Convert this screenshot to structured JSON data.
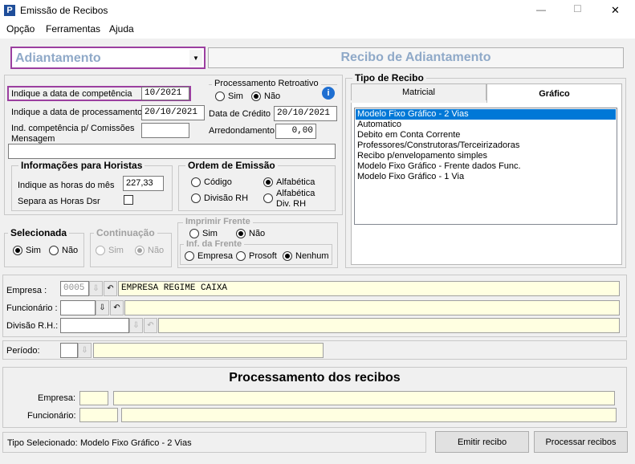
{
  "window": {
    "title": "Emissão de Recibos",
    "minimize": "—",
    "maximize": "☐",
    "close": "✕"
  },
  "menu": {
    "items": [
      "Opção",
      "Ferramentas",
      "Ajuda"
    ]
  },
  "top": {
    "type_value": "Adiantamento",
    "banner": "Recibo de Adiantamento"
  },
  "dates": {
    "competencia_label": "Indique a data de competência",
    "competencia_value": "10/2021",
    "processamento_label": "Indique a data de processamento",
    "processamento_value": "20/10/2021",
    "comissoes_label": "Ind. competência p/ Comissões",
    "mensagem_label": "Mensagem",
    "mensagem_value": "",
    "comissoes_value": ""
  },
  "retro": {
    "title": "Processamento Retroativo",
    "sim": "Sim",
    "nao": "Não",
    "selected": "nao"
  },
  "credito": {
    "label": "Data de Crédito",
    "value": "20/10/2021"
  },
  "arred": {
    "label": "Arredondamento",
    "value": "0,00"
  },
  "horistas": {
    "title": "Informações para Horistas",
    "horas_label": "Indique as horas do mês",
    "horas_value": "227,33",
    "dsr_label": "Separa as Horas Dsr"
  },
  "ordem": {
    "title": "Ordem de Emissão",
    "codigo": "Código",
    "alfabetica": "Alfabética",
    "divisao": "Divisão RH",
    "alfa_div": "Alfabética Div. RH",
    "selected": "alfabetica"
  },
  "tipo": {
    "title": "Tipo de Recibo",
    "tabs": [
      "Matricial",
      "Gráfico"
    ],
    "active_tab": 1,
    "items": [
      "Modelo Fixo Gráfico - 2 Vias",
      "Automatico",
      "Debito em Conta Corrente",
      "Professores/Construtoras/Terceirizadoras",
      "Recibo p/envelopamento simples",
      "Modelo Fixo Gráfico - Frente dados Func.",
      "Modelo Fixo Gráfico - 1 Via"
    ],
    "selected": 0
  },
  "selecionada": {
    "title": "Selecionada",
    "sim": "Sim",
    "nao": "Não"
  },
  "continuacao": {
    "title": "Continuação",
    "sim": "Sim",
    "nao": "Não"
  },
  "frente": {
    "title": "Imprimir Frente",
    "sim": "Sim",
    "nao": "Não",
    "inf_title": "Inf. da Frente",
    "empresa": "Empresa",
    "prosoft": "Prosoft",
    "nenhum": "Nenhum"
  },
  "filters": {
    "empresa_label": "Empresa :",
    "empresa_code": "0005",
    "empresa_name": "EMPRESA REGIME CAIXA",
    "funcionario_label": "Funcionário :",
    "funcionario_code": "",
    "funcionario_name": "",
    "divisao_label": "Divisão R.H.:",
    "divisao_code": "",
    "divisao_name": "",
    "periodo_label": "Período:",
    "periodo_code": "",
    "periodo_name": ""
  },
  "proc": {
    "title": "Processamento dos recibos",
    "empresa_label": "Empresa:",
    "funcionario_label": "Funcionário:"
  },
  "status": {
    "label": "Tipo Selecionado:",
    "value": "Modelo Fixo Gráfico - 2 Vias"
  },
  "buttons": {
    "emitir": "Emitir recibo",
    "processar": "Processar recibos"
  },
  "colors": {
    "accent": "#9b3fa0",
    "selection": "#0078d7",
    "yellow": "#ffffe1",
    "banner_text": "#8fa9c8"
  }
}
